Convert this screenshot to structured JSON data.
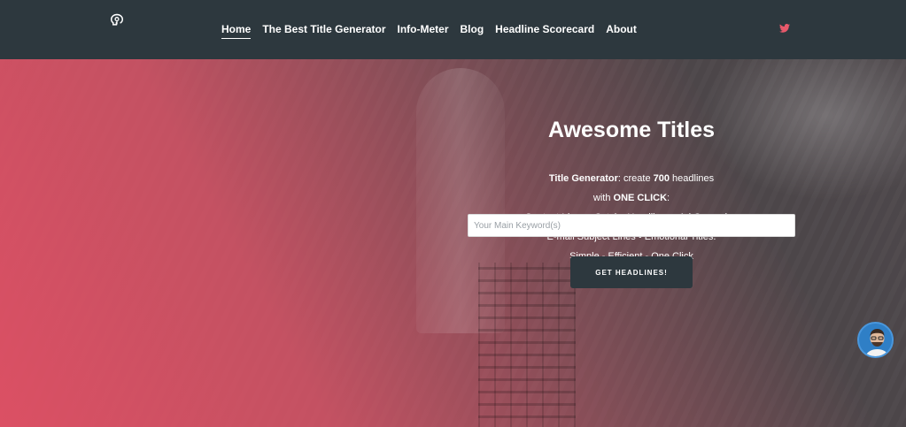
{
  "header": {
    "logo_icon": "brain-lightbulb-icon",
    "nav": [
      {
        "label": "Home",
        "active": true
      },
      {
        "label": "The Best Title Generator",
        "active": false
      },
      {
        "label": "Info-Meter",
        "active": false
      },
      {
        "label": "Blog",
        "active": false
      },
      {
        "label": "Headline Scorecard",
        "active": false
      },
      {
        "label": "About",
        "active": false
      }
    ],
    "social_icon": "twitter-icon"
  },
  "hero": {
    "title": "Awesome Titles",
    "line1_bold": "Title Generator",
    "line1_rest_a": ": create ",
    "line1_count": "700",
    "line1_rest_b": " headlines",
    "line2_a": "with ",
    "line2_bold": "ONE CLICK",
    "line2_b": ":",
    "line3": "Content Ideas • Catchy Headlines • Ad Campaign",
    "line4": "E-mail Subject Lines • Emotional Titles.",
    "line5": "Simple - Efficient - One Click",
    "input_placeholder": "Your Main Keyword(s)",
    "input_value": "",
    "button_label": "GET HEADLINES!"
  },
  "chat": {
    "avatar_icon": "support-avatar-icon"
  },
  "colors": {
    "header_bg": "#2d383e",
    "accent": "#de5064",
    "twitter": "#e8596b",
    "button_bg": "#2d383e"
  }
}
